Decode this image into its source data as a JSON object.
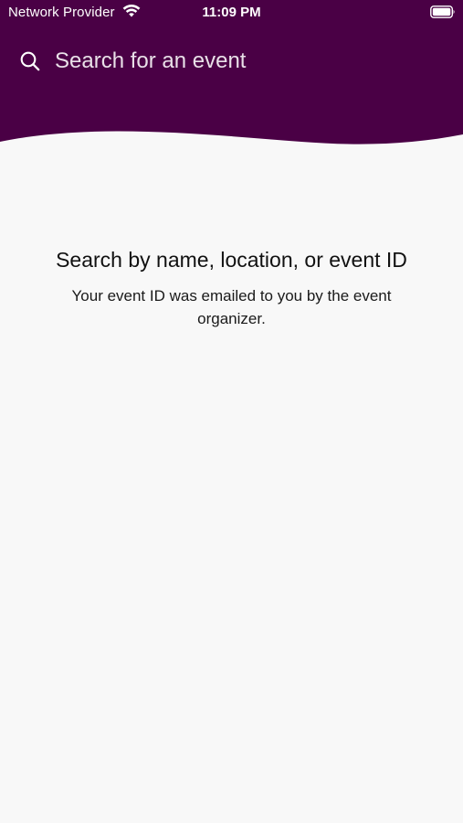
{
  "status_bar": {
    "carrier": "Network Provider",
    "time": "11:09 PM",
    "wifi_icon": "wifi-icon",
    "battery_icon": "battery-icon"
  },
  "search": {
    "placeholder": "Search for an event",
    "value": "",
    "icon": "search-icon"
  },
  "empty_state": {
    "title": "Search by name, location, or event ID",
    "subtitle": "Your event ID was emailed to you by the event organizer."
  },
  "colors": {
    "header_background": "#4a0045",
    "page_background": "#f8f8f8",
    "header_text": "#ffffff",
    "body_text": "#111111"
  }
}
